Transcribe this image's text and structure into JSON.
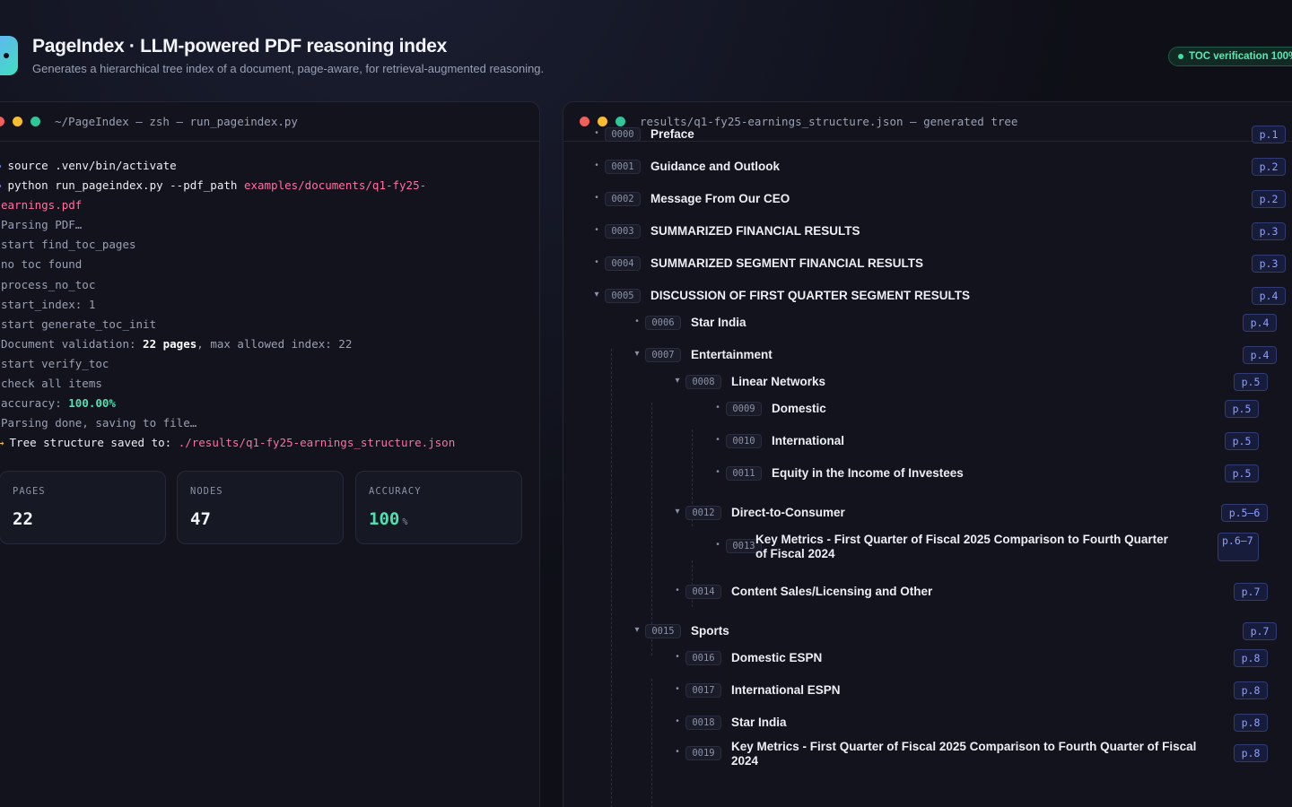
{
  "header": {
    "title": "PageIndex · LLM-powered PDF reasoning index",
    "subtitle": "Generates a hierarchical tree index of a document, page-aware, for retrieval-augmented reasoning.",
    "badge": "TOC verification 100%"
  },
  "terminal": {
    "window_title": "~/PageIndex — zsh — run_pageindex.py",
    "prompt_icon": "chevron-right-icon",
    "lines": {
      "l0": {
        "cmd": "source .venv/bin/activate"
      },
      "l1": {
        "cmd": "python run_pageindex.py --pdf_path ",
        "path": "examples/documents/q1-fy25-"
      },
      "l2": {
        "path": "earnings.pdf"
      },
      "l3": {
        "text": "Parsing PDF…"
      },
      "l4": {
        "text": "start find_toc_pages"
      },
      "l5": {
        "text": "no toc found"
      },
      "l6": {
        "text": "process_no_toc"
      },
      "l7": {
        "text": "start_index: 1"
      },
      "l8": {
        "text": "start generate_toc_init"
      },
      "l9": {
        "pre": "Document validation: ",
        "hl": "22 pages",
        "post": ", max allowed index: 22"
      },
      "l10": {
        "text": "start verify_toc"
      },
      "l11": {
        "text": "check all items"
      },
      "l12": {
        "pre": "accuracy: ",
        "ok": "100.00%"
      },
      "l13": {
        "text": "Parsing done, saving to file…"
      },
      "l14": {
        "cmd": "Tree structure saved to: ",
        "path": "./results/q1-fy25-earnings_structure.json"
      }
    }
  },
  "stats": {
    "pages": {
      "label": "PAGES",
      "value": "22"
    },
    "nodes": {
      "label": "NODES",
      "value": "47"
    },
    "accuracy": {
      "label": "ACCURACY",
      "value": "100",
      "unit": "%"
    }
  },
  "tree": {
    "window_title": "results/q1-fy25-earnings_structure.json — generated tree",
    "nodes": [
      {
        "id": "0000",
        "title": "Preface",
        "page": "p.1",
        "toggle": "•"
      },
      {
        "id": "0001",
        "title": "Guidance and Outlook",
        "page": "p.2",
        "toggle": "•"
      },
      {
        "id": "0002",
        "title": "Message From Our CEO",
        "page": "p.2",
        "toggle": "•"
      },
      {
        "id": "0003",
        "title": "SUMMARIZED FINANCIAL RESULTS",
        "page": "p.3",
        "toggle": "•"
      },
      {
        "id": "0004",
        "title": "SUMMARIZED SEGMENT FINANCIAL RESULTS",
        "page": "p.3",
        "toggle": "•"
      },
      {
        "id": "0005",
        "title": "DISCUSSION OF FIRST QUARTER SEGMENT RESULTS",
        "page": "p.4",
        "toggle": "▾"
      },
      {
        "id": "0006",
        "title": "Star India",
        "page": "p.4",
        "toggle": "•"
      },
      {
        "id": "0007",
        "title": "Entertainment",
        "page": "p.4",
        "toggle": "▾"
      },
      {
        "id": "0008",
        "title": "Linear Networks",
        "page": "p.5",
        "toggle": "▾"
      },
      {
        "id": "0009",
        "title": "Domestic",
        "page": "p.5",
        "toggle": "•"
      },
      {
        "id": "0010",
        "title": "International",
        "page": "p.5",
        "toggle": "•"
      },
      {
        "id": "0011",
        "title": "Equity in the Income of Investees",
        "page": "p.5",
        "toggle": "•"
      },
      {
        "id": "0012",
        "title": "Direct-to-Consumer",
        "page": "p.5–6",
        "toggle": "▾"
      },
      {
        "id": "0013",
        "title": "Key Metrics - First Quarter of Fiscal 2025 Comparison to Fourth Quarter of Fiscal 2024",
        "page": "p.6–7",
        "toggle": "•"
      },
      {
        "id": "0014",
        "title": "Content Sales/Licensing and Other",
        "page": "p.7",
        "toggle": "•"
      },
      {
        "id": "0015",
        "title": "Sports",
        "page": "p.7",
        "toggle": "▾"
      },
      {
        "id": "0016",
        "title": "Domestic ESPN",
        "page": "p.8",
        "toggle": "•"
      },
      {
        "id": "0017",
        "title": "International ESPN",
        "page": "p.8",
        "toggle": "•"
      },
      {
        "id": "0018",
        "title": "Star India",
        "page": "p.8",
        "toggle": "•"
      },
      {
        "id": "0019",
        "title": "Key Metrics - First Quarter of Fiscal 2025 Comparison to Fourth Quarter of Fiscal 2024",
        "page": "p.8",
        "toggle": "•"
      }
    ]
  }
}
